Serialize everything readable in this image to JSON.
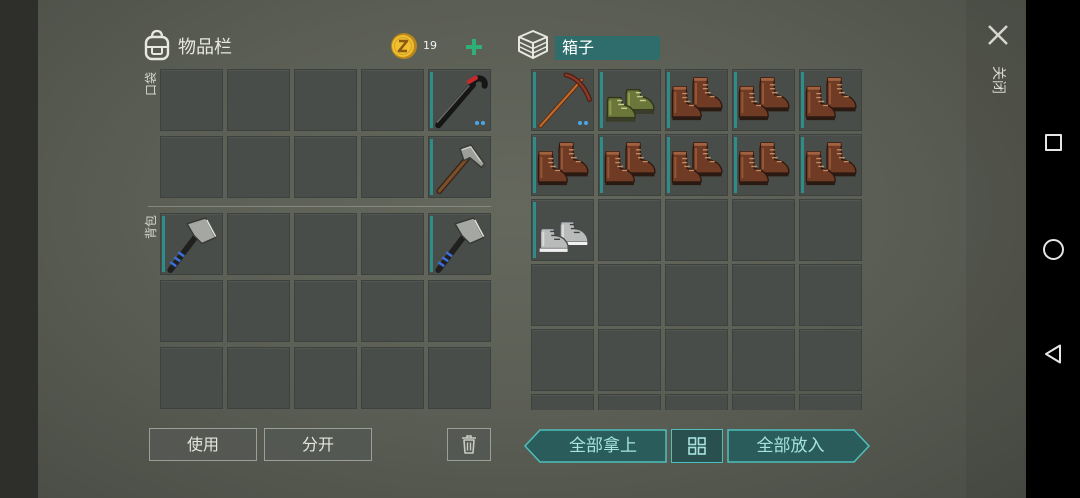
{
  "inventory": {
    "title": "物品栏",
    "coins": "19",
    "pocket_label": "口袋",
    "backpack_label": "背包",
    "pocket": [
      [
        null,
        null,
        null,
        null,
        {
          "item": "crowbar",
          "dots": 2
        }
      ],
      [
        null,
        null,
        null,
        null,
        {
          "item": "hammer"
        }
      ]
    ],
    "backpack": [
      [
        {
          "item": "axe"
        },
        null,
        null,
        null,
        {
          "item": "axe"
        }
      ],
      [
        null,
        null,
        null,
        null,
        null
      ],
      [
        null,
        null,
        null,
        null,
        null
      ]
    ],
    "buttons": {
      "use": "使用",
      "split": "分开"
    }
  },
  "box": {
    "title": "箱子",
    "slots": [
      [
        {
          "item": "pickaxe",
          "dots": 2
        },
        {
          "item": "green-boots"
        },
        {
          "item": "leather-boots"
        },
        {
          "item": "leather-boots"
        },
        {
          "item": "leather-boots"
        }
      ],
      [
        {
          "item": "leather-boots"
        },
        {
          "item": "leather-boots"
        },
        {
          "item": "leather-boots"
        },
        {
          "item": "leather-boots"
        },
        {
          "item": "leather-boots"
        }
      ],
      [
        {
          "item": "sneakers"
        },
        null,
        null,
        null,
        null
      ],
      [
        null,
        null,
        null,
        null,
        null
      ],
      [
        null,
        null,
        null,
        null,
        null
      ],
      [
        null,
        null,
        null,
        null,
        null
      ]
    ]
  },
  "actions": {
    "take_all": "全部拿上",
    "put_all": "全部放入"
  },
  "close_label": "关闭",
  "icons": {
    "inventory": "backpack-icon",
    "currency": "coin-icon",
    "add": "plus-icon",
    "box": "crate-icon",
    "close": "close-icon",
    "trash": "trash-icon",
    "layout_toggle": "grid-icon"
  },
  "colors": {
    "accent_teal": "#2e6d6b",
    "teal_border": "#4cc0bd",
    "button_text": "#a6e3df",
    "quality_bar": "#2e8d8a",
    "durability_dot": "#4aa6e8",
    "plus_green": "#2fae76",
    "coin_gold": "#f0c030"
  }
}
